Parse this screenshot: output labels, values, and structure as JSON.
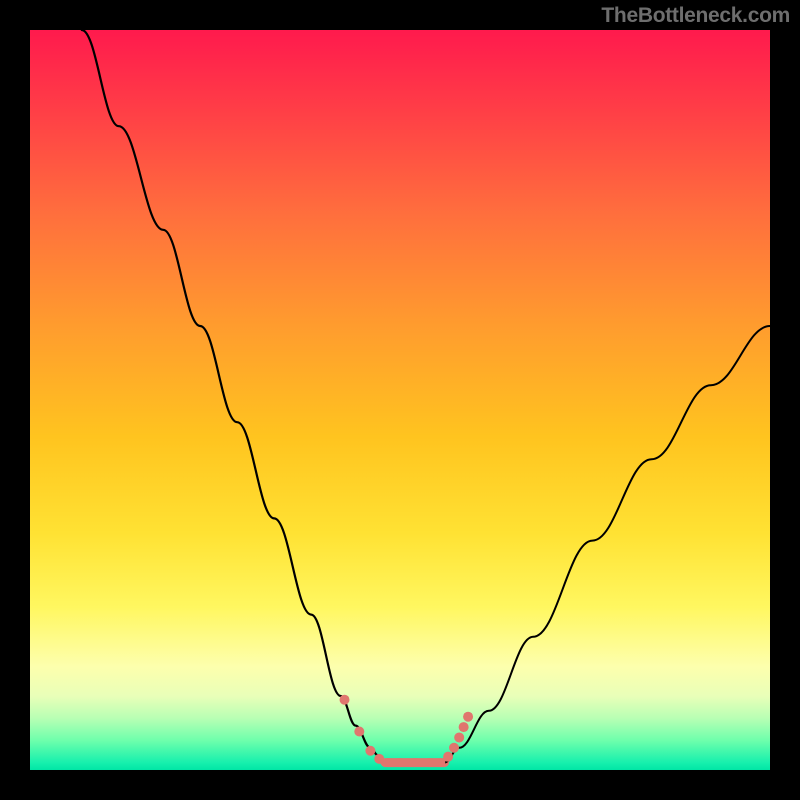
{
  "watermark": "TheBottleneck.com",
  "chart_data": {
    "type": "line",
    "title": "",
    "xlabel": "",
    "ylabel": "",
    "xlim": [
      0,
      100
    ],
    "ylim": [
      0,
      100
    ],
    "grid": false,
    "left_branch": {
      "x": [
        7,
        12,
        18,
        23,
        28,
        33,
        38,
        42,
        44,
        46,
        47,
        48
      ],
      "y": [
        100,
        87,
        73,
        60,
        47,
        34,
        21,
        10,
        6,
        3,
        2,
        1
      ]
    },
    "plateau_segment": {
      "x": [
        48,
        56
      ],
      "y": [
        1,
        1
      ]
    },
    "right_branch": {
      "x": [
        56,
        58,
        62,
        68,
        76,
        84,
        92,
        100
      ],
      "y": [
        1,
        3,
        8,
        18,
        31,
        42,
        52,
        60
      ]
    },
    "markers_left": {
      "x": [
        42.5,
        44.5,
        46,
        47.2
      ],
      "y": [
        9.5,
        5.2,
        2.6,
        1.5
      ]
    },
    "markers_plateau": {
      "x": [
        48.5,
        50,
        52,
        54,
        55.5
      ],
      "y": [
        1,
        1,
        1,
        1,
        1
      ]
    },
    "markers_right": {
      "x": [
        56.5,
        57.3,
        58.0,
        58.6,
        59.2
      ],
      "y": [
        1.8,
        3.0,
        4.4,
        5.8,
        7.2
      ]
    },
    "gradient_stops": [
      {
        "pos": 0.0,
        "color": "#ff1a4d"
      },
      {
        "pos": 0.4,
        "color": "#ff9c2e"
      },
      {
        "pos": 0.7,
        "color": "#ffe233"
      },
      {
        "pos": 0.88,
        "color": "#fdffad"
      },
      {
        "pos": 0.95,
        "color": "#6effac"
      },
      {
        "pos": 1.0,
        "color": "#00e6a6"
      }
    ],
    "marker_color": "#e0766e",
    "curve_color": "#000000"
  }
}
